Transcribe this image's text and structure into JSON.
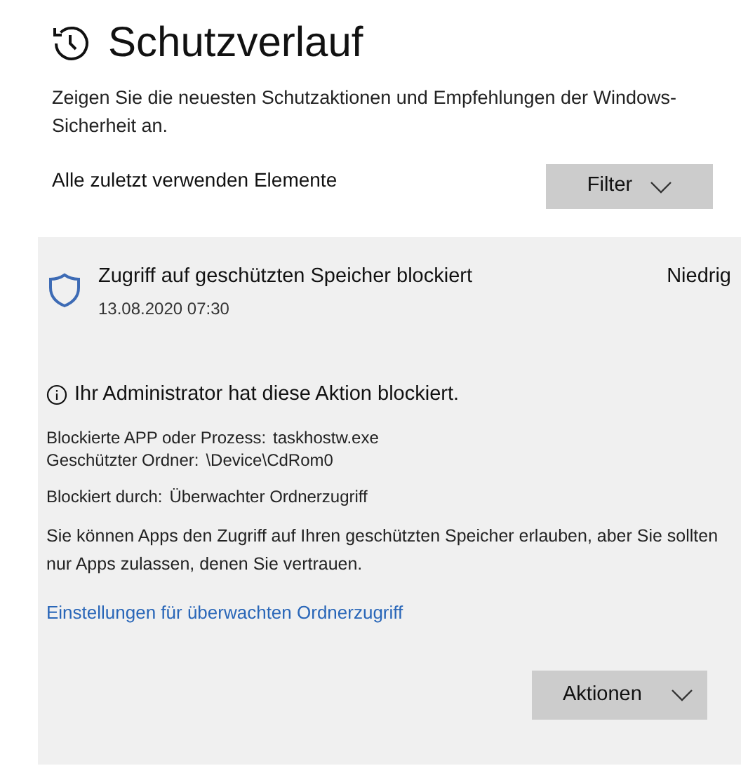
{
  "page": {
    "title": "Schutzverlauf",
    "description": "Zeigen Sie die neuesten Schutzaktionen und Empfehlungen der Windows-Sicherheit an.",
    "list_heading": "Alle zuletzt verwenden Elemente",
    "filter_button": "Filter"
  },
  "event": {
    "title": "Zugriff auf geschützten Speicher blockiert",
    "date": "13.08.2020 07:30",
    "severity": "Niedrig",
    "notice": "Ihr Administrator hat diese Aktion blockiert.",
    "detail_groups": [
      [
        {
          "label": "Blockierte APP oder Prozess:",
          "value": "taskhostw.exe"
        },
        {
          "label": "Geschützter Ordner:",
          "value": "\\Device\\CdRom0"
        }
      ],
      [
        {
          "label": "Blockiert durch:",
          "value": "Überwachter Ordnerzugriff"
        }
      ]
    ],
    "explanation": "Sie können Apps den Zugriff auf Ihren geschützten Speicher erlauben, aber Sie sollten nur Apps zulassen, denen Sie vertrauen.",
    "link": "Einstellungen für überwachten Ordnerzugriff",
    "actions_button": "Aktionen"
  }
}
